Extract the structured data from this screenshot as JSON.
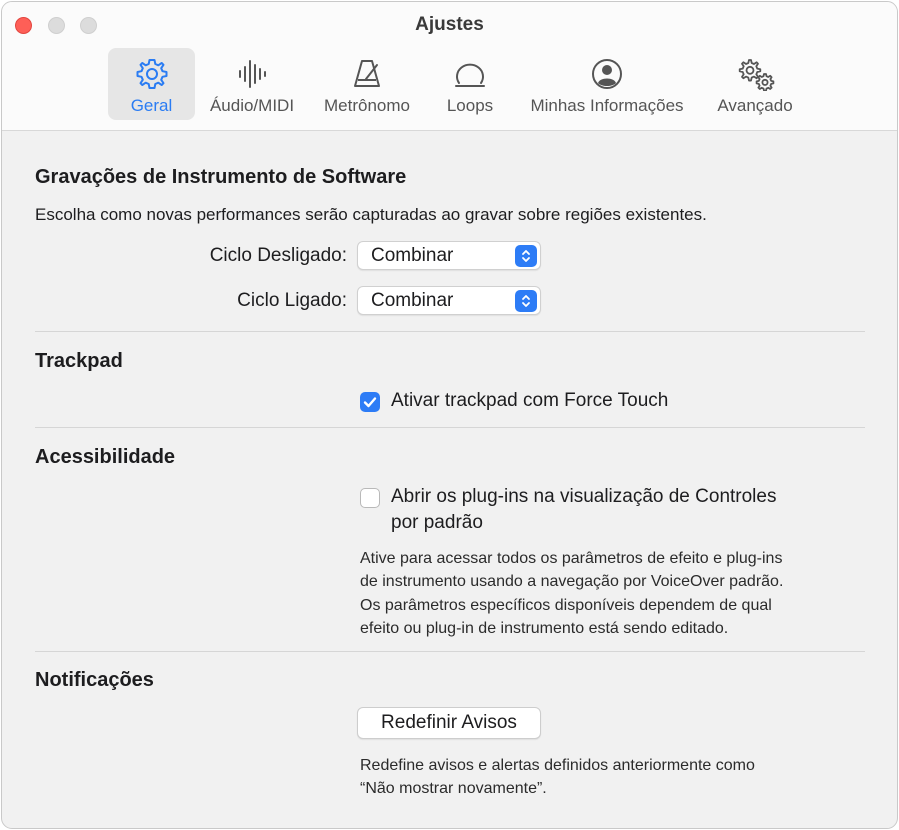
{
  "window": {
    "title": "Ajustes"
  },
  "tabs": [
    {
      "label": "Geral",
      "icon": "gear-icon",
      "active": true
    },
    {
      "label": "Áudio/MIDI",
      "icon": "waveform-icon"
    },
    {
      "label": "Metrônomo",
      "icon": "metronome-icon"
    },
    {
      "label": "Loops",
      "icon": "loop-icon"
    },
    {
      "label": "Minhas Informações",
      "icon": "person-circle-icon"
    },
    {
      "label": "Avançado",
      "icon": "gears-icon"
    }
  ],
  "software": {
    "title": "Gravações de Instrumento de Software",
    "description": "Escolha como novas performances serão capturadas ao gravar sobre regiões existentes.",
    "cycle_off_label": "Ciclo Desligado:",
    "cycle_off_value": "Combinar",
    "cycle_on_label": "Ciclo Ligado:",
    "cycle_on_value": "Combinar"
  },
  "trackpad": {
    "title": "Trackpad",
    "checkbox_label": "Ativar trackpad com Force Touch",
    "checked": true
  },
  "accessibility": {
    "title": "Acessibilidade",
    "checkbox_label_line1": "Abrir os plug-ins na visualização de Controles",
    "checkbox_label_line2": "por padrão",
    "checked": false,
    "help_lines": [
      "Ative para acessar todos os parâmetros de efeito e plug-ins",
      "de instrumento usando a navegação por VoiceOver padrão.",
      "Os parâmetros específicos disponíveis dependem de qual",
      "efeito ou plug-in de instrumento está sendo editado."
    ]
  },
  "notifications": {
    "title": "Notificações",
    "button_label": "Redefinir Avisos",
    "help_lines": [
      "Redefine avisos e alertas definidos anteriormente como",
      "“Não mostrar novamente”."
    ]
  },
  "colors": {
    "accent": "#2d7cf6",
    "close": "#fe5f57",
    "background": "#f1f1f1"
  }
}
